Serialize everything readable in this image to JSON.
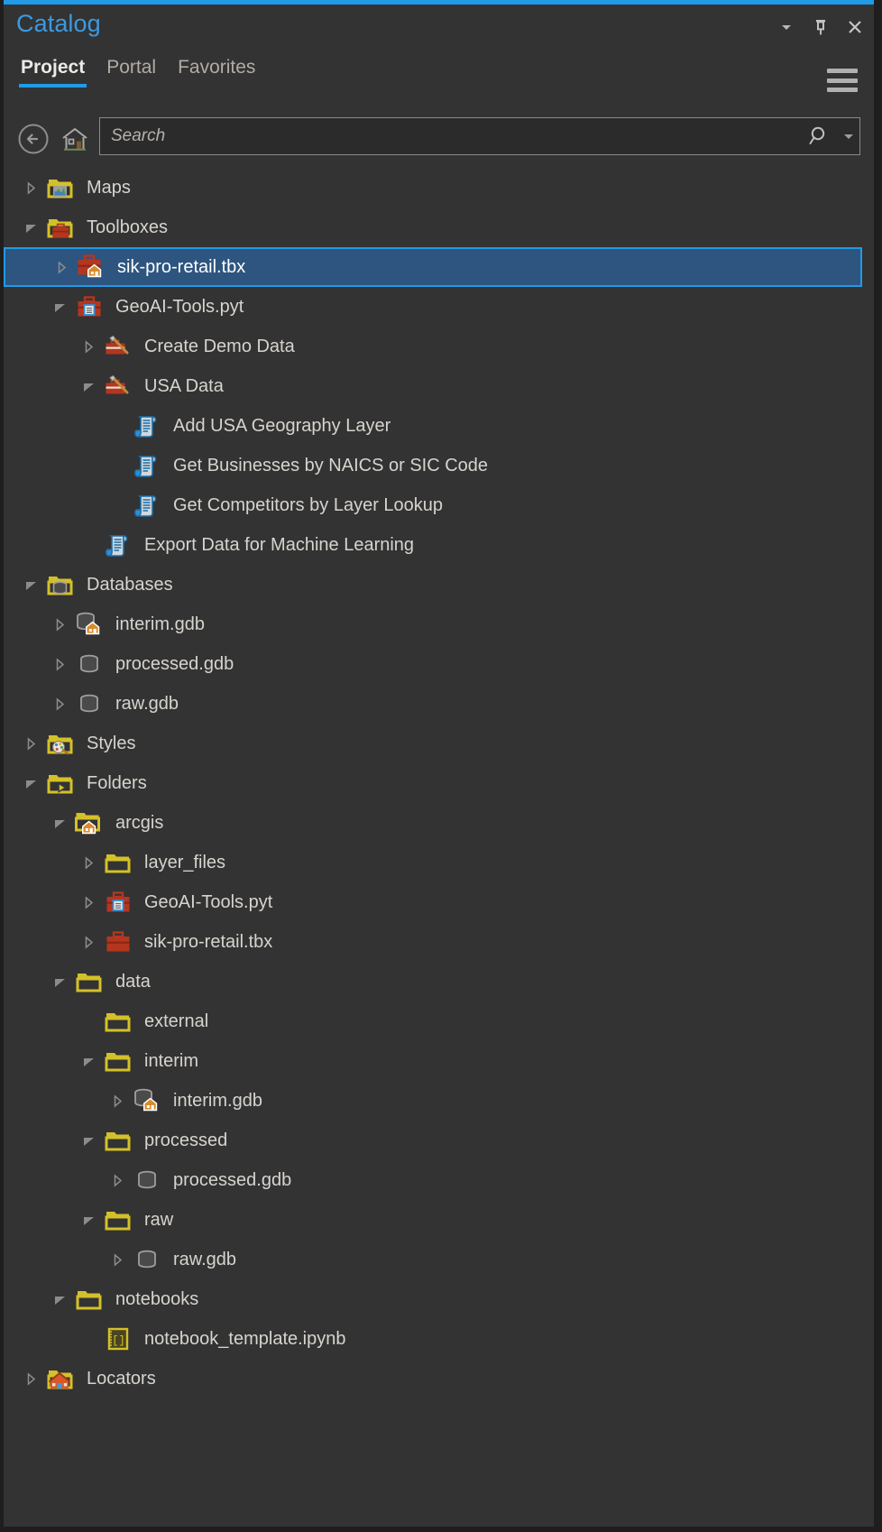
{
  "window": {
    "title": "Catalog",
    "controls": [
      {
        "name": "menu-dropdown",
        "icon": "chevron-down-icon",
        "label": "▼"
      },
      {
        "name": "auto-hide-pin",
        "icon": "pin-icon",
        "label": "⧉"
      },
      {
        "name": "close",
        "icon": "close-icon",
        "label": "✕"
      }
    ]
  },
  "tabs": [
    {
      "label": "Project",
      "active": true
    },
    {
      "label": "Portal",
      "active": false
    },
    {
      "label": "Favorites",
      "active": false
    }
  ],
  "options_menu": {
    "label": "Options",
    "icon": "hamburger-menu-icon"
  },
  "toolbar": {
    "back": {
      "label": "Back",
      "icon": "back-arrow-icon"
    },
    "home": {
      "label": "Home",
      "icon": "home-icon"
    }
  },
  "search": {
    "value": "",
    "placeholder": "Search",
    "search_icon": "search-icon",
    "dropdown_icon": "chevron-down-icon"
  },
  "colors": {
    "accent": "#1f9be8",
    "background": "#333333",
    "text": "#d7d4cf",
    "title": "#3b9ae0",
    "selection_fill": "#2d5580",
    "selection_border": "#1f9be8",
    "folder_yellow": "#d4c029",
    "toolbox_red": "#b4361f",
    "script_blue": "#2e8fd6"
  },
  "tree": [
    {
      "label": "Maps",
      "depth": 0,
      "icon": "folder-maps-icon",
      "state": "collapsed",
      "selected": false
    },
    {
      "label": "Toolboxes",
      "depth": 0,
      "icon": "folder-toolboxes-icon",
      "state": "expanded",
      "selected": false
    },
    {
      "label": "sik-pro-retail.tbx",
      "depth": 1,
      "icon": "toolbox-home-icon",
      "state": "collapsed",
      "selected": true
    },
    {
      "label": "GeoAI-Tools.pyt",
      "depth": 1,
      "icon": "python-toolbox-icon",
      "state": "expanded",
      "selected": false
    },
    {
      "label": "Create Demo Data",
      "depth": 2,
      "icon": "toolset-icon",
      "state": "collapsed",
      "selected": false
    },
    {
      "label": "USA Data",
      "depth": 2,
      "icon": "toolset-icon",
      "state": "expanded",
      "selected": false
    },
    {
      "label": "Add USA Geography Layer",
      "depth": 3,
      "icon": "script-tool-icon",
      "state": "leaf",
      "selected": false
    },
    {
      "label": "Get Businesses by NAICS or SIC Code",
      "depth": 3,
      "icon": "script-tool-icon",
      "state": "leaf",
      "selected": false
    },
    {
      "label": "Get Competitors by Layer Lookup",
      "depth": 3,
      "icon": "script-tool-icon",
      "state": "leaf",
      "selected": false
    },
    {
      "label": "Export Data for Machine Learning",
      "depth": 2,
      "icon": "script-tool-icon",
      "state": "leaf",
      "selected": false
    },
    {
      "label": "Databases",
      "depth": 0,
      "icon": "folder-databases-icon",
      "state": "expanded",
      "selected": false
    },
    {
      "label": "interim.gdb",
      "depth": 1,
      "icon": "geodatabase-home-icon",
      "state": "collapsed",
      "selected": false
    },
    {
      "label": "processed.gdb",
      "depth": 1,
      "icon": "geodatabase-icon",
      "state": "collapsed",
      "selected": false
    },
    {
      "label": "raw.gdb",
      "depth": 1,
      "icon": "geodatabase-icon",
      "state": "collapsed",
      "selected": false
    },
    {
      "label": "Styles",
      "depth": 0,
      "icon": "folder-styles-icon",
      "state": "collapsed",
      "selected": false
    },
    {
      "label": "Folders",
      "depth": 0,
      "icon": "folder-folders-icon",
      "state": "expanded",
      "selected": false
    },
    {
      "label": "arcgis",
      "depth": 1,
      "icon": "folder-home-icon",
      "state": "expanded",
      "selected": false
    },
    {
      "label": "layer_files",
      "depth": 2,
      "icon": "folder-icon",
      "state": "collapsed",
      "selected": false
    },
    {
      "label": "GeoAI-Tools.pyt",
      "depth": 2,
      "icon": "python-toolbox-icon",
      "state": "collapsed",
      "selected": false
    },
    {
      "label": "sik-pro-retail.tbx",
      "depth": 2,
      "icon": "toolbox-icon",
      "state": "collapsed",
      "selected": false
    },
    {
      "label": "data",
      "depth": 1,
      "icon": "folder-icon",
      "state": "expanded",
      "selected": false
    },
    {
      "label": "external",
      "depth": 2,
      "icon": "folder-icon",
      "state": "leaf",
      "selected": false
    },
    {
      "label": "interim",
      "depth": 2,
      "icon": "folder-icon",
      "state": "expanded",
      "selected": false
    },
    {
      "label": "interim.gdb",
      "depth": 3,
      "icon": "geodatabase-home-icon",
      "state": "collapsed",
      "selected": false
    },
    {
      "label": "processed",
      "depth": 2,
      "icon": "folder-icon",
      "state": "expanded",
      "selected": false
    },
    {
      "label": "processed.gdb",
      "depth": 3,
      "icon": "geodatabase-icon",
      "state": "collapsed",
      "selected": false
    },
    {
      "label": "raw",
      "depth": 2,
      "icon": "folder-icon",
      "state": "expanded",
      "selected": false
    },
    {
      "label": "raw.gdb",
      "depth": 3,
      "icon": "geodatabase-icon",
      "state": "collapsed",
      "selected": false
    },
    {
      "label": "notebooks",
      "depth": 1,
      "icon": "folder-icon",
      "state": "expanded",
      "selected": false
    },
    {
      "label": "notebook_template.ipynb",
      "depth": 2,
      "icon": "notebook-icon",
      "state": "leaf",
      "selected": false
    },
    {
      "label": "Locators",
      "depth": 0,
      "icon": "folder-locators-icon",
      "state": "collapsed",
      "selected": false
    }
  ]
}
